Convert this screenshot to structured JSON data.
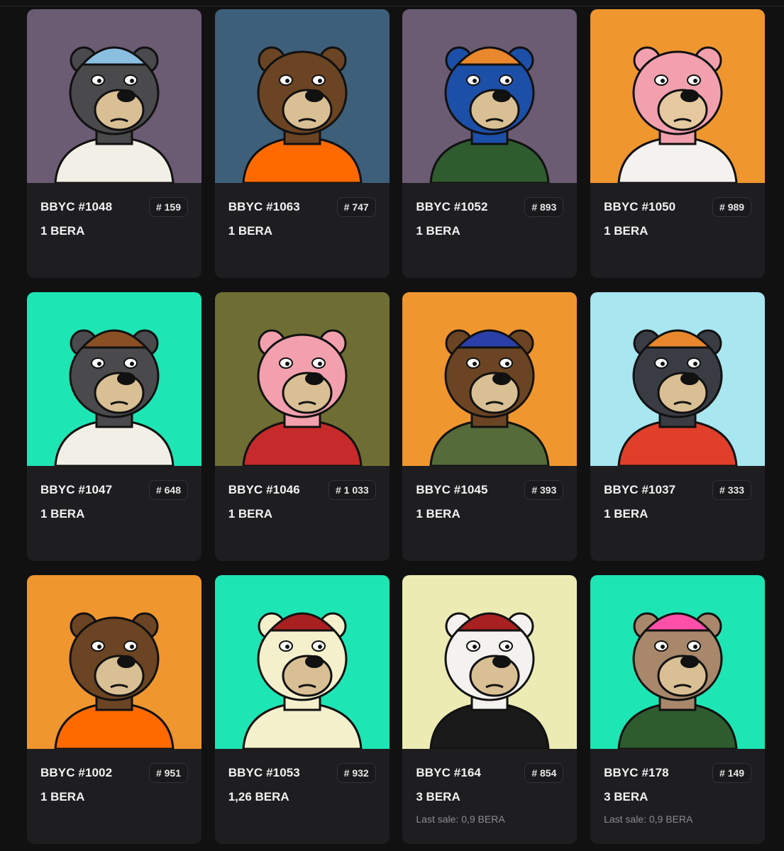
{
  "cards": [
    {
      "name": "BBYC #1048",
      "rank": "# 159",
      "price": "1 BERA",
      "last_sale": "",
      "bg": "#6b5b73",
      "fur": "#4a4a4c",
      "muzzle": "#d9bf94",
      "shirt": "#f2f0e6",
      "hat": "#8bbfe0",
      "icon": "bear-sailor-image"
    },
    {
      "name": "BBYC #1063",
      "rank": "# 747",
      "price": "1 BERA",
      "last_sale": "",
      "bg": "#3e5f7a",
      "fur": "#6b4423",
      "muzzle": "#d9bf94",
      "shirt": "#ff6a00",
      "hat": "",
      "icon": "bear-laser-eyes-image"
    },
    {
      "name": "BBYC #1052",
      "rank": "# 893",
      "price": "1 BERA",
      "last_sale": "",
      "bg": "#6b5b73",
      "fur": "#1c4fa8",
      "muzzle": "#d9bf94",
      "shirt": "#2f5c2f",
      "hat": "#e8872b",
      "icon": "bear-blue-beanie-image"
    },
    {
      "name": "BBYC #1050",
      "rank": "# 989",
      "price": "1 BERA",
      "last_sale": "",
      "bg": "#f0962e",
      "fur": "#f2a0ad",
      "muzzle": "#e6c9a0",
      "shirt": "#f4f2ee",
      "hat": "",
      "icon": "bear-pink-star-image"
    },
    {
      "name": "BBYC #1047",
      "rank": "# 648",
      "price": "1 BERA",
      "last_sale": "",
      "bg": "#1de6b4",
      "fur": "#4a4a4c",
      "muzzle": "#d9bf94",
      "shirt": "#f2f0e6",
      "hat": "#8a4f23",
      "icon": "bear-aviator-image"
    },
    {
      "name": "BBYC #1046",
      "rank": "# 1 033",
      "price": "1 BERA",
      "last_sale": "",
      "bg": "#6e6e34",
      "fur": "#f2a0ad",
      "muzzle": "#d9bf94",
      "shirt": "#c62a2a",
      "hat": "",
      "icon": "bear-pink-flannel-image"
    },
    {
      "name": "BBYC #1045",
      "rank": "# 393",
      "price": "1 BERA",
      "last_sale": "",
      "bg": "#f0962e",
      "fur": "#6b4423",
      "muzzle": "#d9bf94",
      "shirt": "#556b3a",
      "hat": "#2a3fa8",
      "icon": "bear-army-helmet-image"
    },
    {
      "name": "BBYC #1037",
      "rank": "# 333",
      "price": "1 BERA",
      "last_sale": "",
      "bg": "#a8e6f0",
      "fur": "#3a3c44",
      "muzzle": "#d9bf94",
      "shirt": "#e0402a",
      "hat": "#e8872b",
      "icon": "bear-robot-hawaiian-image"
    },
    {
      "name": "BBYC #1002",
      "rank": "# 951",
      "price": "1 BERA",
      "last_sale": "",
      "bg": "#f0962e",
      "fur": "#6b4423",
      "muzzle": "#d9bf94",
      "shirt": "#ff6a00",
      "hat": "",
      "icon": "bear-goggles-prison-image"
    },
    {
      "name": "BBYC #1053",
      "rank": "# 932",
      "price": "1,26 BERA",
      "last_sale": "",
      "bg": "#1de6b4",
      "fur": "#f4f0cc",
      "muzzle": "#d9bf94",
      "shirt": "#f4f0cc",
      "hat": "#a82020",
      "icon": "bear-polar-fez-image"
    },
    {
      "name": "BBYC #164",
      "rank": "# 854",
      "price": "3 BERA",
      "last_sale": "Last sale: 0,9 BERA",
      "bg": "#ecebb4",
      "fur": "#f4f2ee",
      "muzzle": "#d9bf94",
      "shirt": "#1a1a1a",
      "hat": "#a82020",
      "icon": "bear-skeleton-fez-image"
    },
    {
      "name": "BBYC #178",
      "rank": "# 149",
      "price": "3 BERA",
      "last_sale": "Last sale: 0,9 BERA",
      "bg": "#1de6b4",
      "fur": "#a8876a",
      "muzzle": "#d9bf94",
      "shirt": "#2f5c2f",
      "hat": "#ff4fa8",
      "icon": "bear-pink-hair-image"
    }
  ]
}
